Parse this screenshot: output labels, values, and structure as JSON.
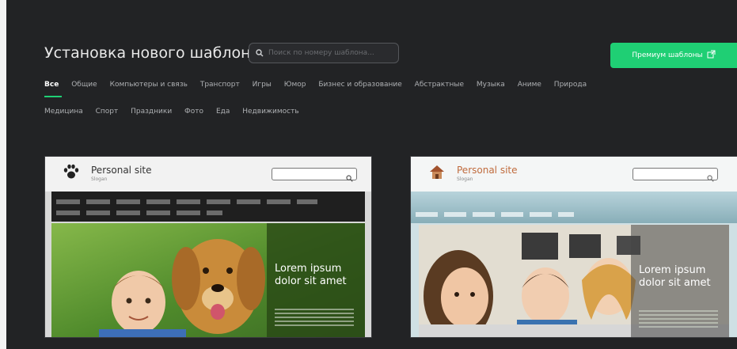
{
  "header": {
    "title": "Установка нового шаблона",
    "search_placeholder": "Поиск по номеру шаблона...",
    "premium_label": "Премиум шаблоны"
  },
  "categories": {
    "row1": [
      "Все",
      "Общие",
      "Компьютеры и связь",
      "Транспорт",
      "Игры",
      "Юмор",
      "Бизнес и образование",
      "Абстрактные",
      "Музыка",
      "Аниме",
      "Природа"
    ],
    "row2": [
      "Медицина",
      "Спорт",
      "Праздники",
      "Фото",
      "Еда",
      "Недвижимость"
    ],
    "active": "Все"
  },
  "templates": [
    {
      "site_name": "Personal site",
      "slogan": "Slogan",
      "hero_text": "Lorem ipsum dolor sit amet"
    },
    {
      "site_name": "Personal site",
      "slogan": "Slogan",
      "hero_text": "Lorem ipsum dolor sit amet"
    }
  ],
  "colors": {
    "accent": "#1fcf74",
    "panel_bg": "#222325"
  },
  "icons": {
    "search": "search-icon",
    "external": "external-link-icon",
    "paw": "paw-icon",
    "house": "house-icon"
  }
}
